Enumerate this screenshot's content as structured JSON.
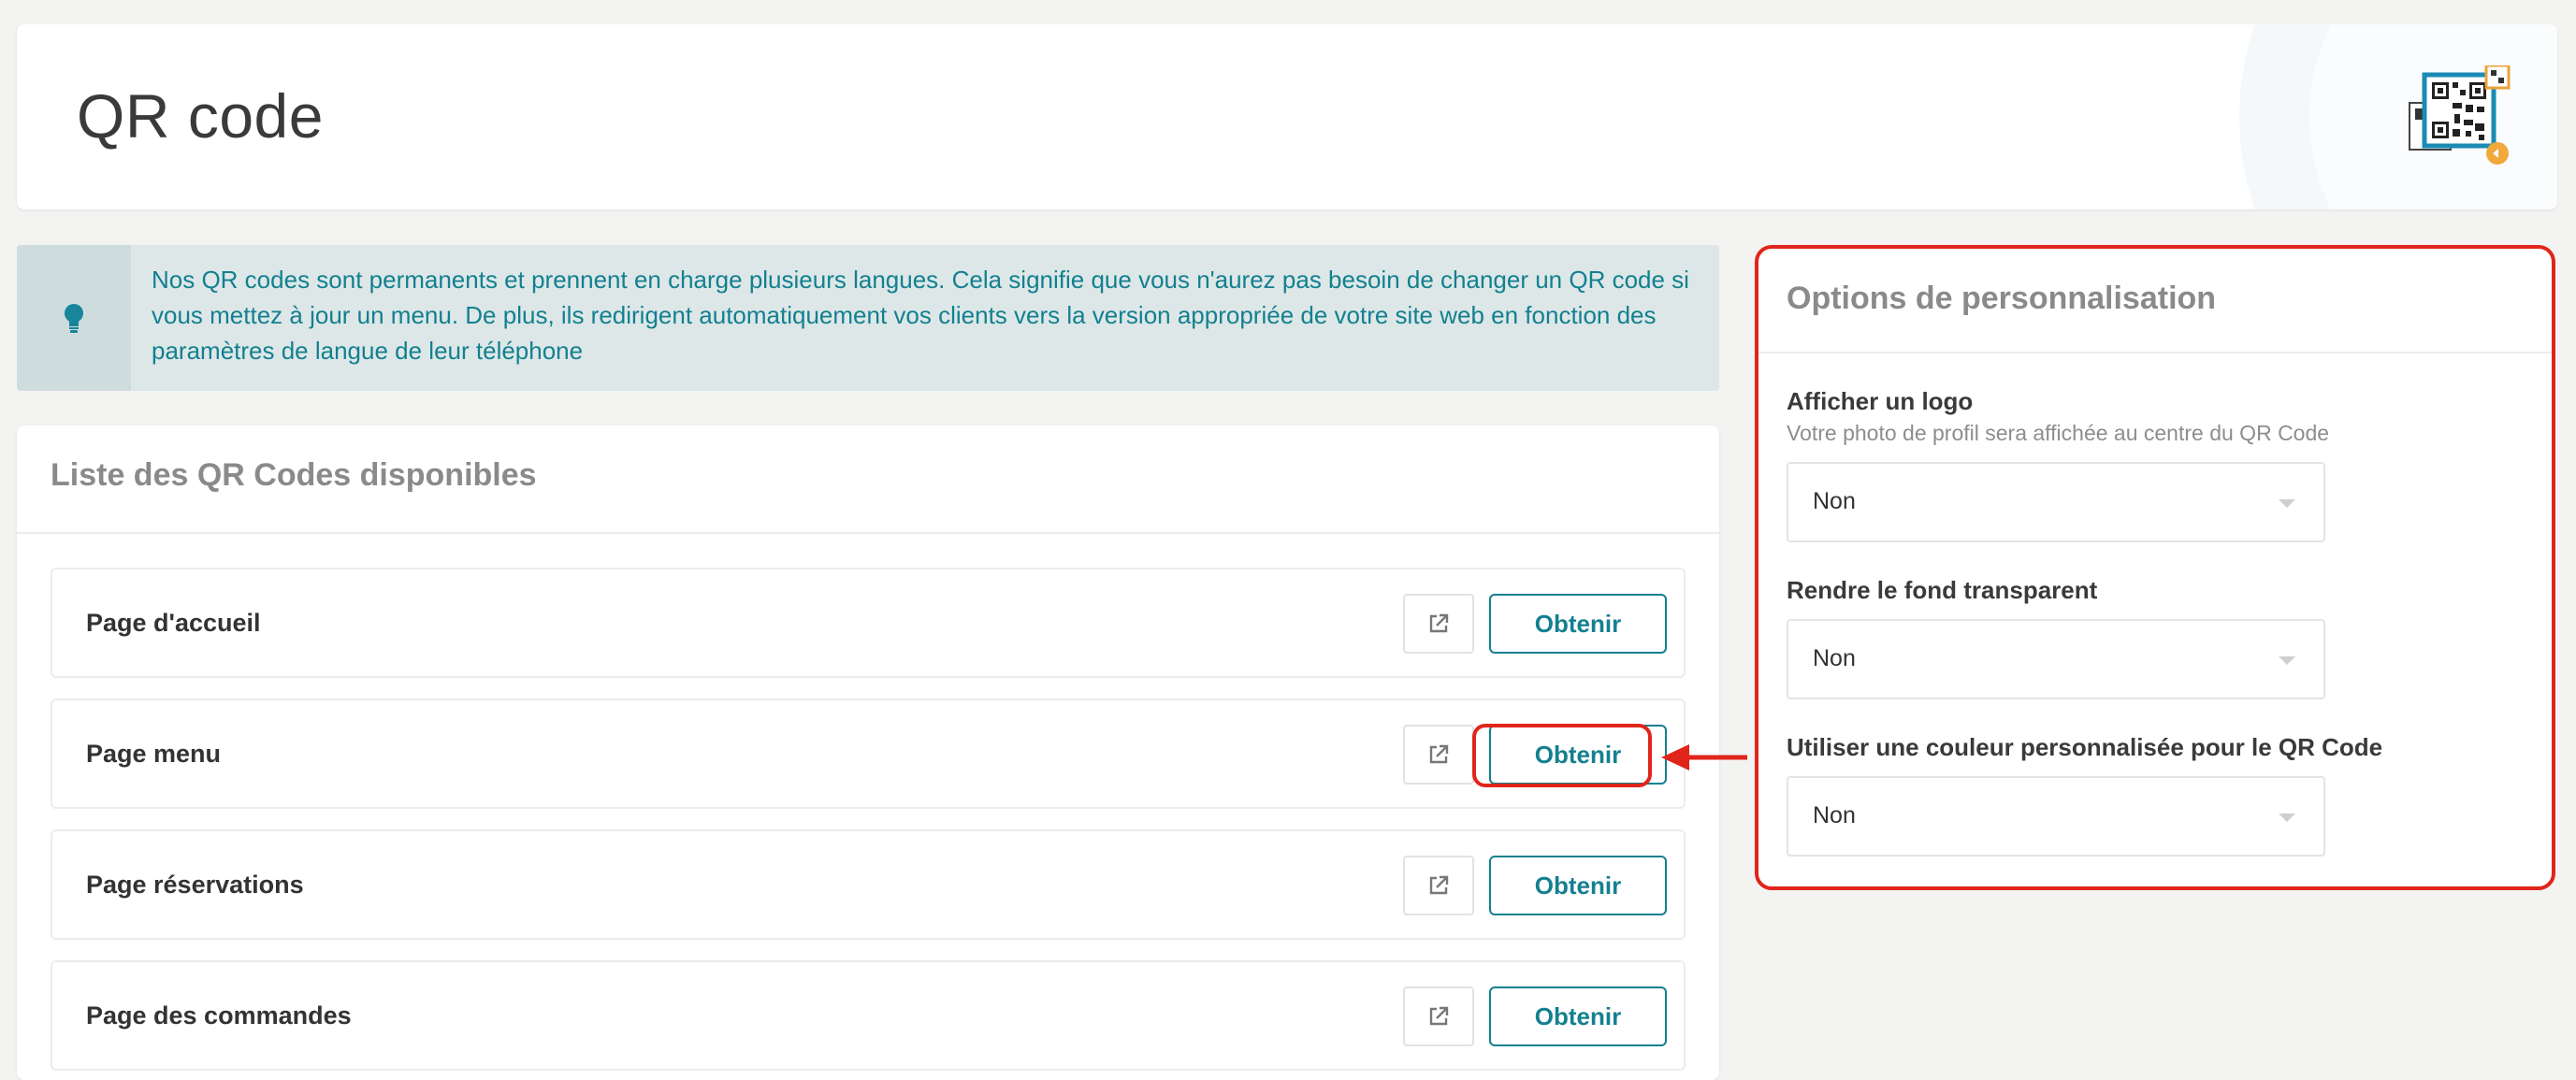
{
  "header": {
    "title": "QR code"
  },
  "info": {
    "text": "Nos QR codes sont permanents et prennent en charge plusieurs langues. Cela signifie que vous n'aurez pas besoin de changer un QR code si vous mettez à jour un menu. De plus, ils redirigent automatiquement vos clients vers la version appropriée de votre site web en fonction des paramètres de langue de leur téléphone",
    "icon": "lightbulb-icon"
  },
  "list": {
    "title": "Liste des QR Codes disponibles",
    "rows": [
      {
        "label": "Page d'accueil",
        "button": "Obtenir"
      },
      {
        "label": "Page menu",
        "button": "Obtenir"
      },
      {
        "label": "Page réservations",
        "button": "Obtenir"
      },
      {
        "label": "Page des commandes",
        "button": "Obtenir"
      }
    ]
  },
  "options": {
    "title": "Options de personnalisation",
    "logo": {
      "label": "Afficher un logo",
      "help": "Votre photo de profil sera affichée au centre du QR Code",
      "value": "Non"
    },
    "transparent": {
      "label": "Rendre le fond transparent",
      "value": "Non"
    },
    "color": {
      "label": "Utiliser une couleur personnalisée pour le QR Code",
      "value": "Non"
    }
  },
  "colors": {
    "accent": "#14808f",
    "highlight": "#e1251b",
    "info_bg": "#dde7e8"
  }
}
